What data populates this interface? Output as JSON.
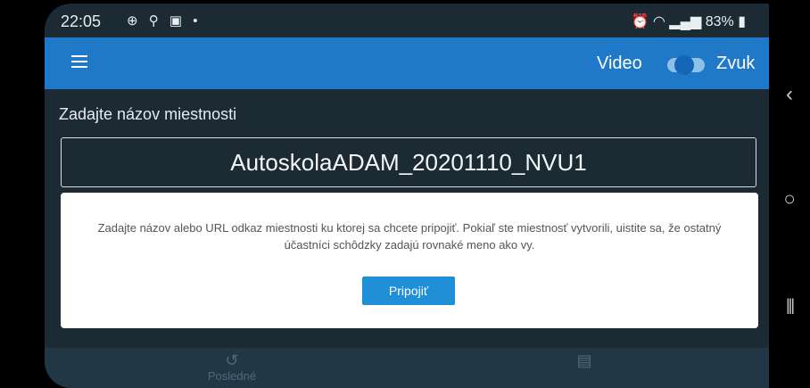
{
  "status_bar": {
    "time": "22:05",
    "left_icons": "⊕ ⚲ ▣ •",
    "battery": "83%"
  },
  "app_bar": {
    "video_label": "Video",
    "sound_label": "Zvuk",
    "toggle_state": "on"
  },
  "room": {
    "prompt": "Zadajte názov miestnosti",
    "value": "AutoskolaADAM_20201110_NVU1"
  },
  "info_card": {
    "text": "Zadajte názov alebo URL odkaz miestnosti ku ktorej sa chcete pripojiť. Pokiaľ ste miestnosť vytvorili, uistite sa, že ostatný účastníci schôdzky zadajú rovnaké meno ako vy.",
    "button": "Pripojiť"
  },
  "bottom_nav": {
    "recent_label": "Posledné",
    "recent_icon": "history-icon",
    "calendar_icon": "calendar-icon"
  },
  "system_nav": {
    "back_icon": "back-chevron-icon",
    "home_icon": "home-circle-icon",
    "recents_icon": "recents-icon"
  },
  "colors": {
    "accent": "#1f78c8",
    "background": "#1b2a33",
    "button": "#1f8fd8"
  }
}
